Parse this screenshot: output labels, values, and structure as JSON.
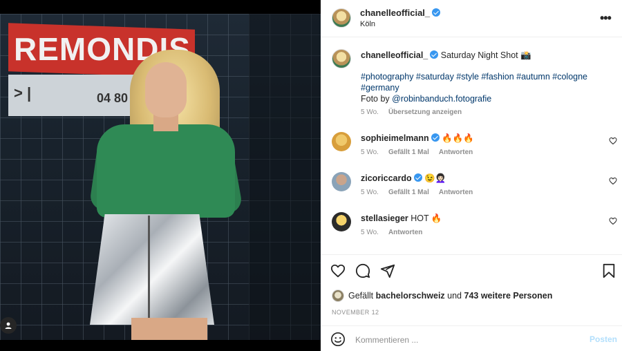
{
  "post": {
    "username": "chanelleofficial_",
    "location": "Köln"
  },
  "caption": {
    "username": "chanelleofficial_",
    "title": "Saturday Night Shot 📸",
    "hashtags_line1": "#photography #saturday #style #fashion #autumn #cologne",
    "hashtags_line2": "#germany",
    "credit_prefix": "Foto by ",
    "credit_handle": "@robinbanduch.fotografie",
    "age": "5 Wo.",
    "translate": "Übersetzung anzeigen"
  },
  "comments": [
    {
      "username": "sophieimelmann",
      "text": "🔥🔥🔥",
      "age": "5 Wo.",
      "likes": "Gefällt 1 Mal",
      "reply": "Antworten"
    },
    {
      "username": "zicoriccardo",
      "text": "😉👩🏻‍🦱",
      "age": "5 Wo.",
      "likes": "Gefällt 1 Mal",
      "reply": "Antworten"
    },
    {
      "username": "stellasieger",
      "text": "HOT 🔥",
      "age": "5 Wo.",
      "reply": "Antworten"
    }
  ],
  "likes": {
    "prefix": "Gefällt ",
    "user": "bachelorschweiz",
    "middle": " und ",
    "others": "743 weitere Personen"
  },
  "date": "NOVEMBER 12",
  "comment_box": {
    "placeholder": "Kommentieren ...",
    "post_label": "Posten"
  },
  "photo": {
    "sign_text": "REMONDIS",
    "sign_lower": "> |",
    "sign_number": "04 80"
  },
  "icons": {
    "more": "more-options-icon",
    "like": "heart-icon",
    "comment": "comment-icon",
    "share": "share-icon",
    "save": "bookmark-icon",
    "emoji": "emoji-icon",
    "user_tag": "user-tag-icon"
  },
  "colors": {
    "verified": "#3897f0",
    "link": "#00376b",
    "post_disabled": "#b2dffc",
    "top_green": "#2f8a55",
    "sign_red": "#c8322b"
  }
}
